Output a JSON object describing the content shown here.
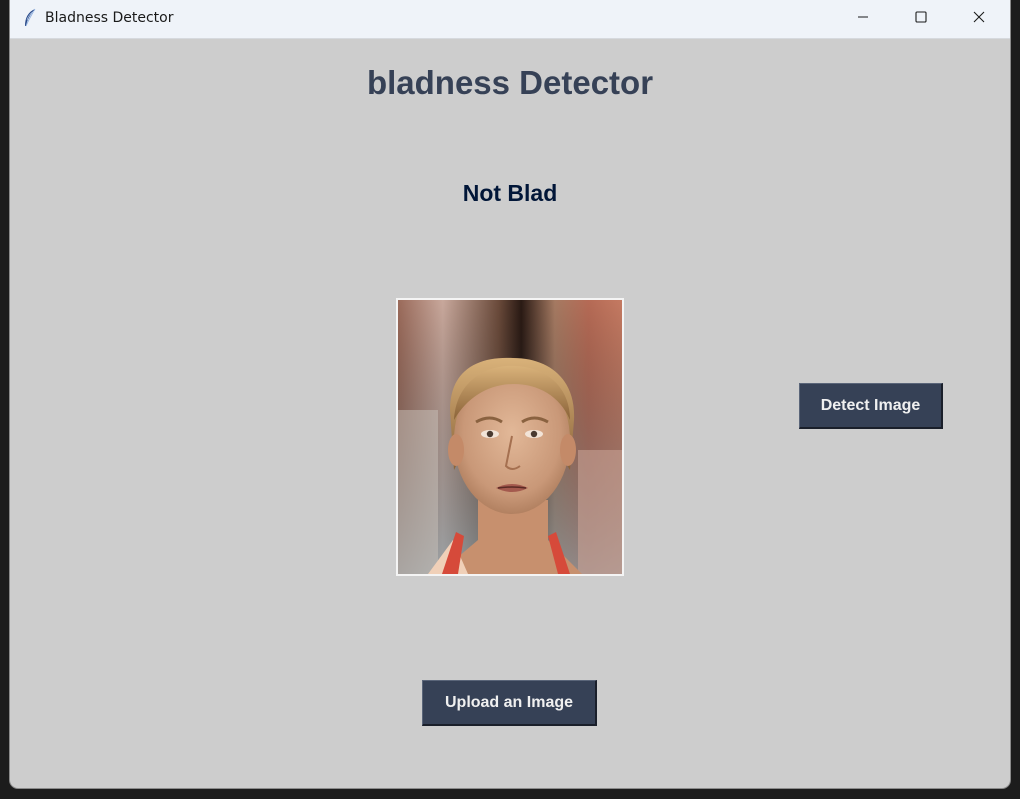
{
  "window": {
    "title": "Bladness Detector",
    "icon": "feather-icon"
  },
  "window_controls": {
    "minimize": "minimize-icon",
    "maximize": "maximize-icon",
    "close": "close-icon"
  },
  "main": {
    "heading": "bladness Detector",
    "result": "Not Blad",
    "detect_button_label": "Detect Image",
    "upload_button_label": "Upload an Image"
  },
  "colors": {
    "background": "#cdcdcd",
    "heading": "#364156",
    "result": "#011638",
    "button_bg": "#364156",
    "button_text": "#f0f0f0"
  }
}
